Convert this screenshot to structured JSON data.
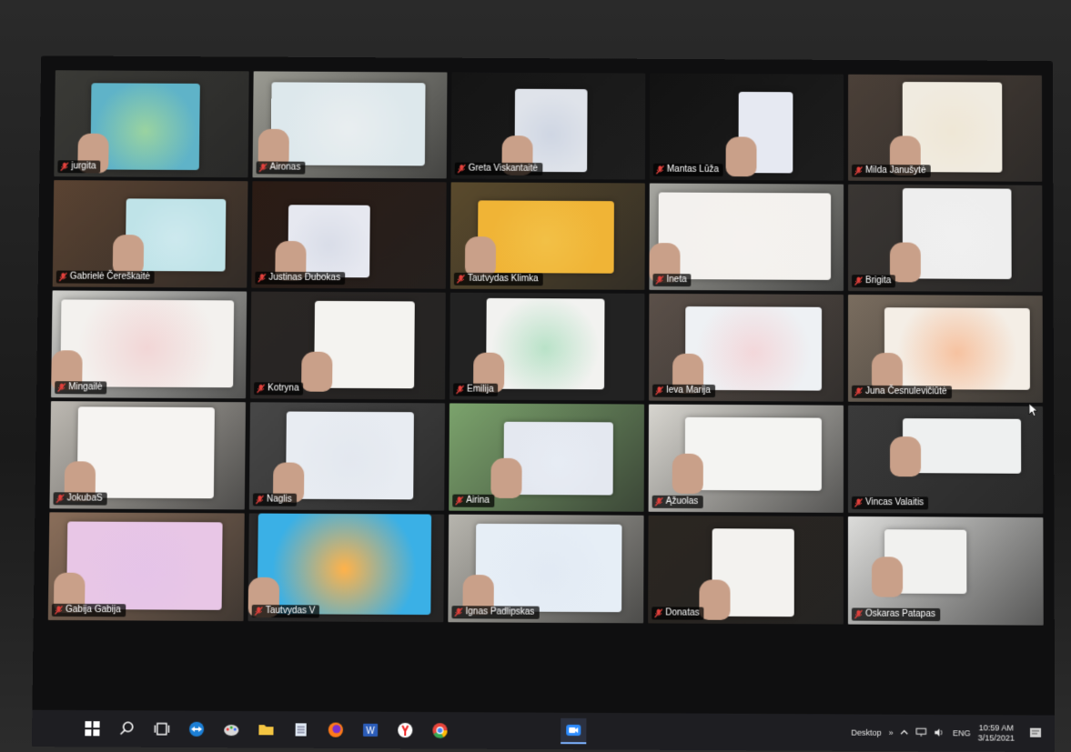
{
  "participants": [
    {
      "name": "jurgita"
    },
    {
      "name": "Aironas"
    },
    {
      "name": "Greta Viskantaitė"
    },
    {
      "name": "Mantas Lūža"
    },
    {
      "name": "Milda Janušytė"
    },
    {
      "name": "Gabrielė Čereškaitė"
    },
    {
      "name": "Justinas Dubokas"
    },
    {
      "name": "Tautvydas Klimka"
    },
    {
      "name": "Ineta"
    },
    {
      "name": "Brigita"
    },
    {
      "name": "Mingailė"
    },
    {
      "name": "Kotryna"
    },
    {
      "name": "Emilija"
    },
    {
      "name": "Ieva Marija"
    },
    {
      "name": "Juna Česnulevičiūtė"
    },
    {
      "name": "JokubaS"
    },
    {
      "name": "Naglis"
    },
    {
      "name": "Airina"
    },
    {
      "name": "Ąžuolas"
    },
    {
      "name": "Vincas Valaitis"
    },
    {
      "name": "Gabija Gabija"
    },
    {
      "name": "Tautvydas V"
    },
    {
      "name": "Ignas Padlipskas"
    },
    {
      "name": "Donatas"
    },
    {
      "name": "Oskaras Patapas"
    }
  ],
  "taskbar": {
    "desktop_label": "Desktop",
    "chevron": "»",
    "language": "ENG",
    "time": "10:59 AM",
    "date": "3/15/2021",
    "icons": [
      "windows-start-icon",
      "search-icon",
      "task-view-icon",
      "teamviewer-icon",
      "paint-icon",
      "file-explorer-icon",
      "notepad-icon",
      "firefox-icon",
      "word-icon",
      "yandex-icon",
      "chrome-icon",
      "zoom-icon"
    ]
  }
}
